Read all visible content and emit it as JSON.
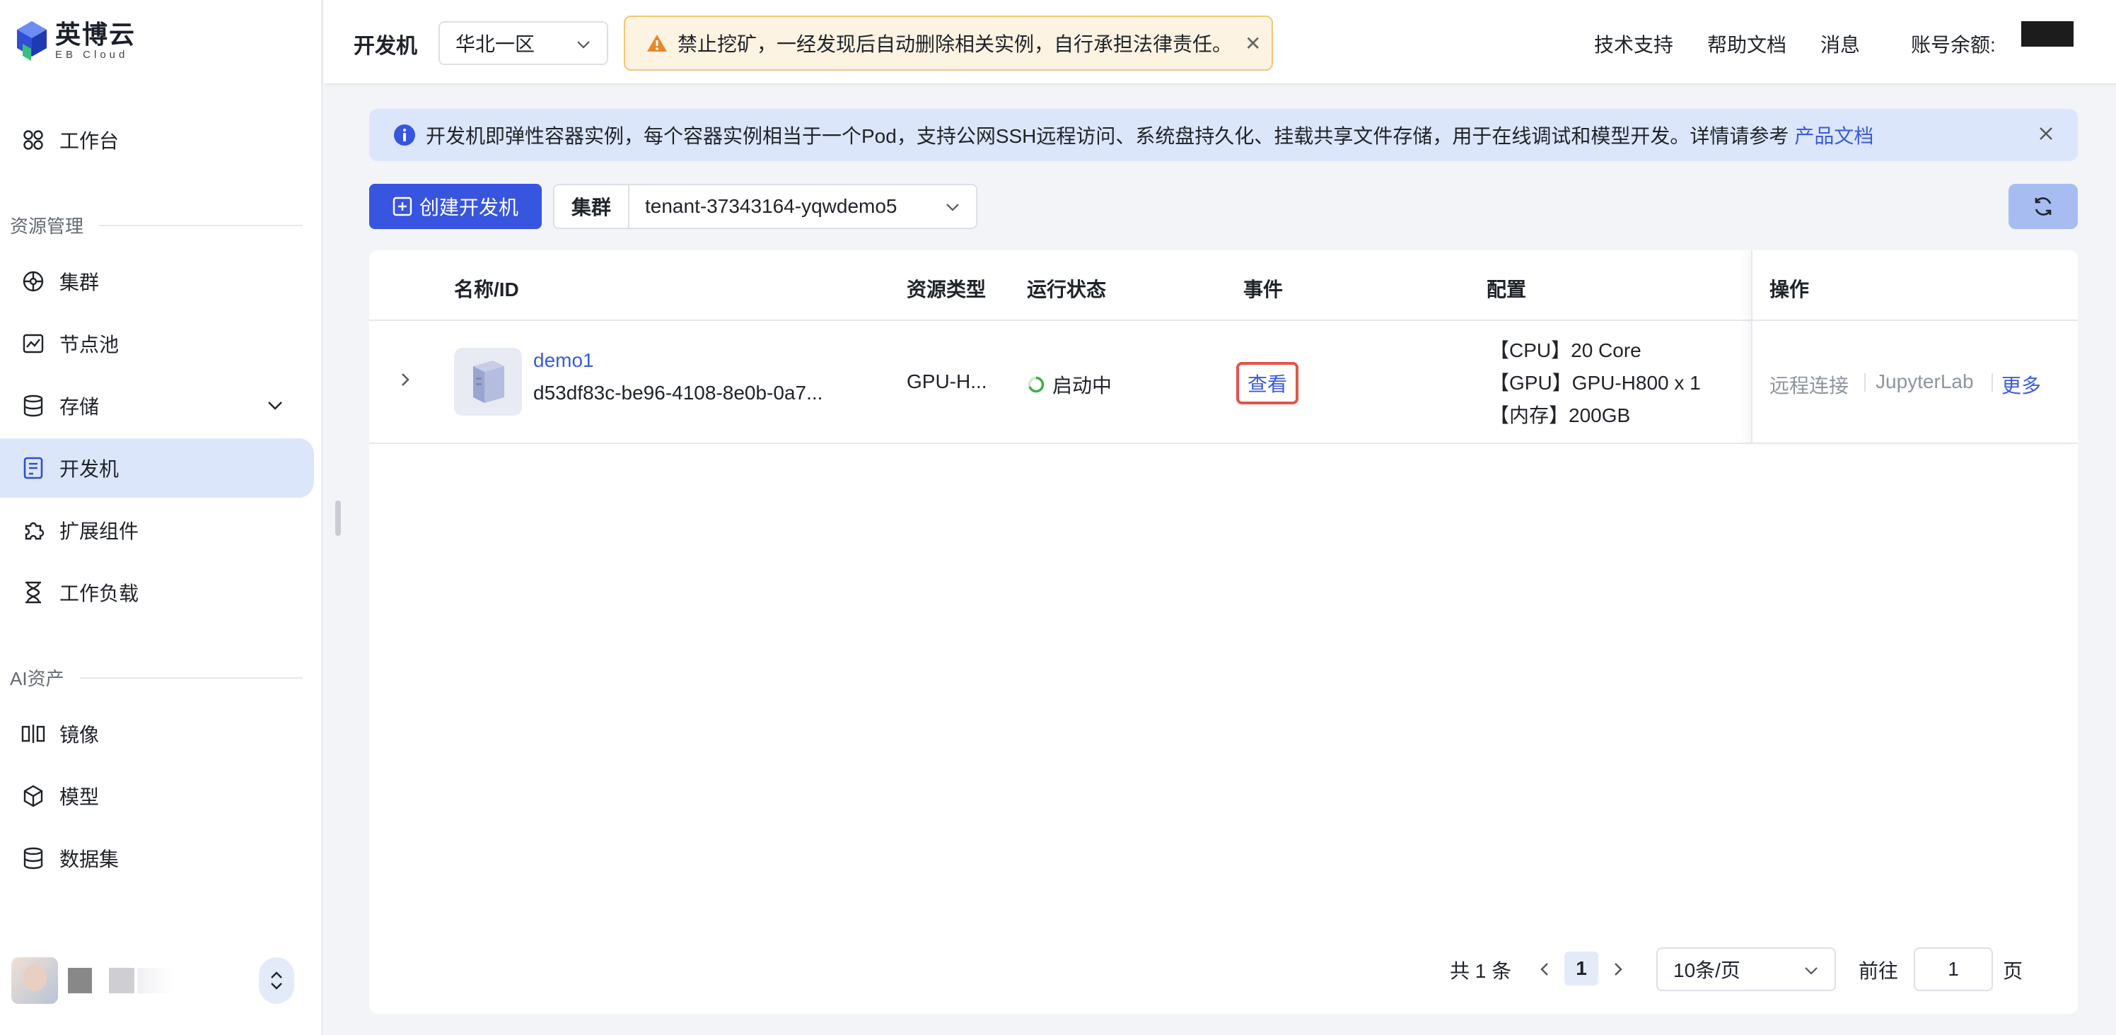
{
  "brand": {
    "name_cn": "英博云",
    "name_en": "EB Cloud",
    "colors": {
      "primary": "#3755de",
      "accent_blue": "#3a5bdb",
      "warning_bg": "#fdf3e3",
      "danger": "#e0564a"
    }
  },
  "sidebar": {
    "workbench": "工作台",
    "section_resources": "资源管理",
    "resources": [
      {
        "label": "集群",
        "icon": "cluster-icon"
      },
      {
        "label": "节点池",
        "icon": "node-pool-icon"
      },
      {
        "label": "存储",
        "icon": "storage-icon"
      },
      {
        "label": "开发机",
        "icon": "devbox-icon",
        "active": true
      },
      {
        "label": "扩展组件",
        "icon": "puzzle-icon"
      },
      {
        "label": "工作负载",
        "icon": "hourglass-icon"
      }
    ],
    "section_ai": "AI资产",
    "ai_assets": [
      {
        "label": "镜像",
        "icon": "image-icon"
      },
      {
        "label": "模型",
        "icon": "cube-icon"
      },
      {
        "label": "数据集",
        "icon": "database-icon"
      }
    ]
  },
  "header": {
    "title": "开发机",
    "region": "华北一区",
    "warning": "禁止挖矿，一经发现后自动删除相关实例，自行承担法律责任。",
    "links": [
      "技术支持",
      "帮助文档",
      "消息"
    ],
    "balance_label": "账号余额:"
  },
  "info": {
    "text": "开发机即弹性容器实例，每个容器实例相当于一个Pod，支持公网SSH远程访问、系统盘持久化、挂载共享文件存储，用于在线调试和模型开发。详情请参考",
    "link": "产品文档"
  },
  "toolbar": {
    "create_label": "创建开发机",
    "cluster_label": "集群",
    "cluster_value": "tenant-37343164-yqwdemo5"
  },
  "table": {
    "columns": [
      "名称/ID",
      "资源类型",
      "运行状态",
      "事件",
      "配置",
      "操作"
    ],
    "rows": [
      {
        "name": "demo1",
        "id": "d53df83c-be96-4108-8e0b-0a7...",
        "resource_type": "GPU-H...",
        "status": "启动中",
        "event": "查看",
        "config": [
          "【CPU】20 Core",
          "【GPU】GPU-H800 x 1",
          "【内存】200GB"
        ],
        "actions": [
          "远程连接",
          "JupyterLab",
          "更多"
        ]
      }
    ]
  },
  "pagination": {
    "total": "共 1 条",
    "current": "1",
    "page_size": "10条/页",
    "goto_label": "前往",
    "goto_value": "1",
    "page_suffix": "页"
  }
}
